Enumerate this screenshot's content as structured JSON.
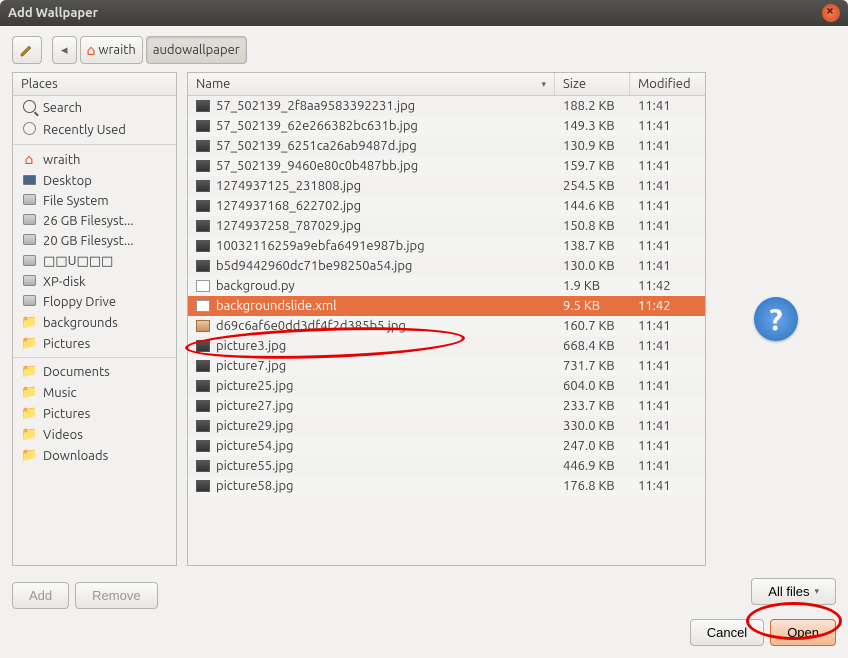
{
  "title": "Add Wallpaper",
  "breadcrumb": {
    "back_enabled": false,
    "home": "wraith",
    "current": "audowallpaper"
  },
  "places_header": "Places",
  "places": [
    {
      "icon": "search",
      "label": "Search"
    },
    {
      "icon": "clock",
      "label": "Recently Used"
    },
    {
      "sep": true
    },
    {
      "icon": "home",
      "label": "wraith"
    },
    {
      "icon": "monitor",
      "label": "Desktop"
    },
    {
      "icon": "disk",
      "label": "File System"
    },
    {
      "icon": "disk",
      "label": "26 GB Filesyst..."
    },
    {
      "icon": "disk",
      "label": "20 GB Filesyst..."
    },
    {
      "icon": "disk",
      "label": "□□U□□□"
    },
    {
      "icon": "disk",
      "label": "XP-disk"
    },
    {
      "icon": "disk",
      "label": "Floppy Drive"
    },
    {
      "icon": "folder",
      "label": "backgrounds"
    },
    {
      "icon": "folder-pic",
      "label": "Pictures"
    },
    {
      "sep": true
    },
    {
      "icon": "folder-doc",
      "label": "Documents"
    },
    {
      "icon": "folder-music",
      "label": "Music"
    },
    {
      "icon": "folder-pic",
      "label": "Pictures"
    },
    {
      "icon": "folder-vid",
      "label": "Videos"
    },
    {
      "icon": "folder-dl",
      "label": "Downloads"
    }
  ],
  "columns": {
    "name": "Name",
    "size": "Size",
    "modified": "Modified"
  },
  "files": [
    {
      "icon": "img",
      "name": "57_502139_2f8aa9583392231.jpg",
      "size": "188.2 KB",
      "mod": "11:41"
    },
    {
      "icon": "img",
      "name": "57_502139_62e266382bc631b.jpg",
      "size": "149.3 KB",
      "mod": "11:41"
    },
    {
      "icon": "img",
      "name": "57_502139_6251ca26ab9487d.jpg",
      "size": "130.9 KB",
      "mod": "11:41"
    },
    {
      "icon": "img",
      "name": "57_502139_9460e80c0b487bb.jpg",
      "size": "159.7 KB",
      "mod": "11:41"
    },
    {
      "icon": "img",
      "name": "1274937125_231808.jpg",
      "size": "254.5 KB",
      "mod": "11:41"
    },
    {
      "icon": "img",
      "name": "1274937168_622702.jpg",
      "size": "144.6 KB",
      "mod": "11:41"
    },
    {
      "icon": "img",
      "name": "1274937258_787029.jpg",
      "size": "150.8 KB",
      "mod": "11:41"
    },
    {
      "icon": "img",
      "name": "10032116259a9ebfa6491e987b.jpg",
      "size": "138.7 KB",
      "mod": "11:41"
    },
    {
      "icon": "img",
      "name": "b5d9442960dc71be98250a54.jpg",
      "size": "130.0 KB",
      "mod": "11:41"
    },
    {
      "icon": "txt",
      "name": "backgroud.py",
      "size": "1.9 KB",
      "mod": "11:42"
    },
    {
      "icon": "txt",
      "name": "backgroundslide.xml",
      "size": "9.5 KB",
      "mod": "11:42",
      "selected": true
    },
    {
      "icon": "thumb",
      "name": "d69c6af6e0dd3df4f2d385b5.jpg",
      "size": "160.7 KB",
      "mod": "11:41"
    },
    {
      "icon": "img",
      "name": "picture3.jpg",
      "size": "668.4 KB",
      "mod": "11:41"
    },
    {
      "icon": "img",
      "name": "picture7.jpg",
      "size": "731.7 KB",
      "mod": "11:41"
    },
    {
      "icon": "img",
      "name": "picture25.jpg",
      "size": "604.0 KB",
      "mod": "11:41"
    },
    {
      "icon": "img",
      "name": "picture27.jpg",
      "size": "233.7 KB",
      "mod": "11:41"
    },
    {
      "icon": "img",
      "name": "picture29.jpg",
      "size": "330.0 KB",
      "mod": "11:41"
    },
    {
      "icon": "img",
      "name": "picture54.jpg",
      "size": "247.0 KB",
      "mod": "11:41"
    },
    {
      "icon": "img",
      "name": "picture55.jpg",
      "size": "446.9 KB",
      "mod": "11:41"
    },
    {
      "icon": "img",
      "name": "picture58.jpg",
      "size": "176.8 KB",
      "mod": "11:41"
    }
  ],
  "buttons": {
    "add": "Add",
    "remove": "Remove",
    "filter": "All files",
    "cancel": "Cancel",
    "open": "Open"
  }
}
